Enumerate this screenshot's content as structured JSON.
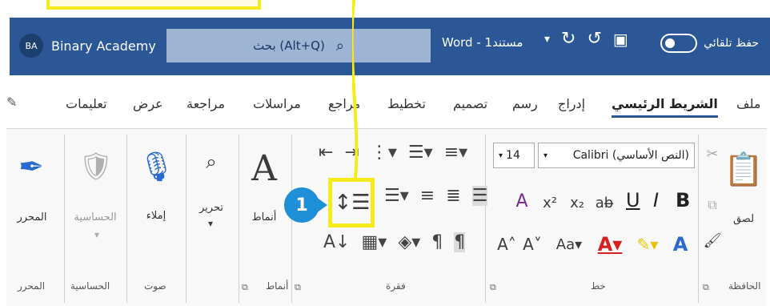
{
  "titlebar": {
    "avatar_initials": "BA",
    "account_name": "Binary Academy",
    "search_text": "بحث (Alt+Q)",
    "doc_title": "مستند1 - Word",
    "autosave_label": "حفظ تلقائي"
  },
  "tabs": [
    {
      "label": "ملف"
    },
    {
      "label": "الشريط الرئيسي",
      "active": true
    },
    {
      "label": "إدراج"
    },
    {
      "label": "رسم"
    },
    {
      "label": "تصميم"
    },
    {
      "label": "تخطيط"
    },
    {
      "label": "مراجع"
    },
    {
      "label": "مراسلات"
    },
    {
      "label": "مراجعة"
    },
    {
      "label": "عرض"
    },
    {
      "label": "تعليمات"
    }
  ],
  "ribbon": {
    "clipboard": {
      "paste_label": "لصق",
      "group_label": "الحافظة"
    },
    "font": {
      "font_name": "(النص الأساسي) Calibri",
      "font_size": "14",
      "bold": "B",
      "italic": "I",
      "underline": "U",
      "group_label": "خط"
    },
    "paragraph": {
      "group_label": "فقرة"
    },
    "styles": {
      "label": "أنماط",
      "group_label": "أنماط"
    },
    "editing": {
      "label": "تحرير"
    },
    "voice": {
      "dictate_label": "إملاء",
      "group_label": "صوت"
    },
    "sensitivity": {
      "label": "الحساسية",
      "group_label": "الحساسية"
    },
    "editor": {
      "label": "المحرر",
      "group_label": "المحرر"
    }
  },
  "annotation": {
    "marker": "1",
    "highlight_color": "#f5ea1a",
    "marker_color": "#1f8fd8"
  },
  "colors": {
    "titlebar": "#2b5797"
  }
}
